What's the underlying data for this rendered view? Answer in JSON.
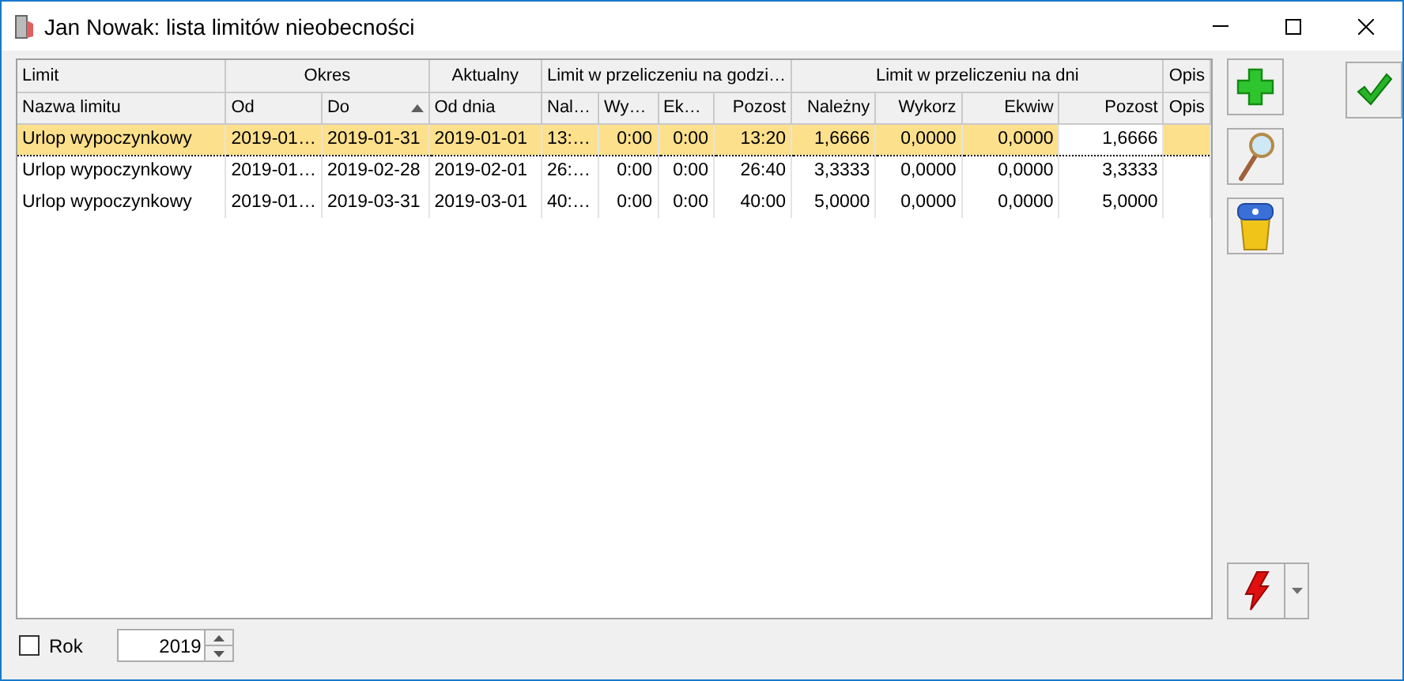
{
  "window": {
    "title": "Jan Nowak: lista limitów nieobecności"
  },
  "table": {
    "groups": [
      {
        "label": "Limit",
        "columns": [
          {
            "label": "Nazwa limitu"
          }
        ]
      },
      {
        "label": "Okres",
        "columns": [
          {
            "label": "Od"
          },
          {
            "label": "Do",
            "sorted_ascending": true
          }
        ]
      },
      {
        "label": "Aktualny",
        "columns": [
          {
            "label": "Od dnia"
          }
        ]
      },
      {
        "label": "Limit w przeliczeniu na godzi…",
        "columns": [
          {
            "label": "Nal…"
          },
          {
            "label": "Wy…"
          },
          {
            "label": "Ek…"
          },
          {
            "label": "Pozost"
          }
        ]
      },
      {
        "label": "Limit w przeliczeniu na dni",
        "columns": [
          {
            "label": "Należny"
          },
          {
            "label": "Wykorz"
          },
          {
            "label": "Ekwiw"
          },
          {
            "label": "Pozost",
            "focused": true
          }
        ]
      },
      {
        "label": "Opis",
        "columns": [
          {
            "label": "Opis"
          }
        ]
      }
    ],
    "rows": [
      {
        "selected": true,
        "cells": [
          "Urlop wypoczynkowy",
          "2019-01…",
          "2019-01-31",
          "2019-01-01",
          "13:…",
          "0:00",
          "0:00",
          "13:20",
          "1,6666",
          "0,0000",
          "0,0000",
          "1,6666"
        ]
      },
      {
        "selected": false,
        "cells": [
          "Urlop wypoczynkowy",
          "2019-01…",
          "2019-02-28",
          "2019-02-01",
          "26:…",
          "0:00",
          "0:00",
          "26:40",
          "3,3333",
          "0,0000",
          "0,0000",
          "3,3333"
        ]
      },
      {
        "selected": false,
        "cells": [
          "Urlop wypoczynkowy",
          "2019-01…",
          "2019-03-31",
          "2019-03-01",
          "40:…",
          "0:00",
          "0:00",
          "40:00",
          "5,0000",
          "0,0000",
          "0,0000",
          "5,0000"
        ]
      }
    ]
  },
  "toolbar": [
    {
      "kind": "add"
    },
    {
      "kind": "view"
    },
    {
      "kind": "delete"
    }
  ],
  "footer": {
    "year_filter": {
      "label": "Rok",
      "checked": false
    },
    "year": {
      "value": "2019"
    }
  }
}
